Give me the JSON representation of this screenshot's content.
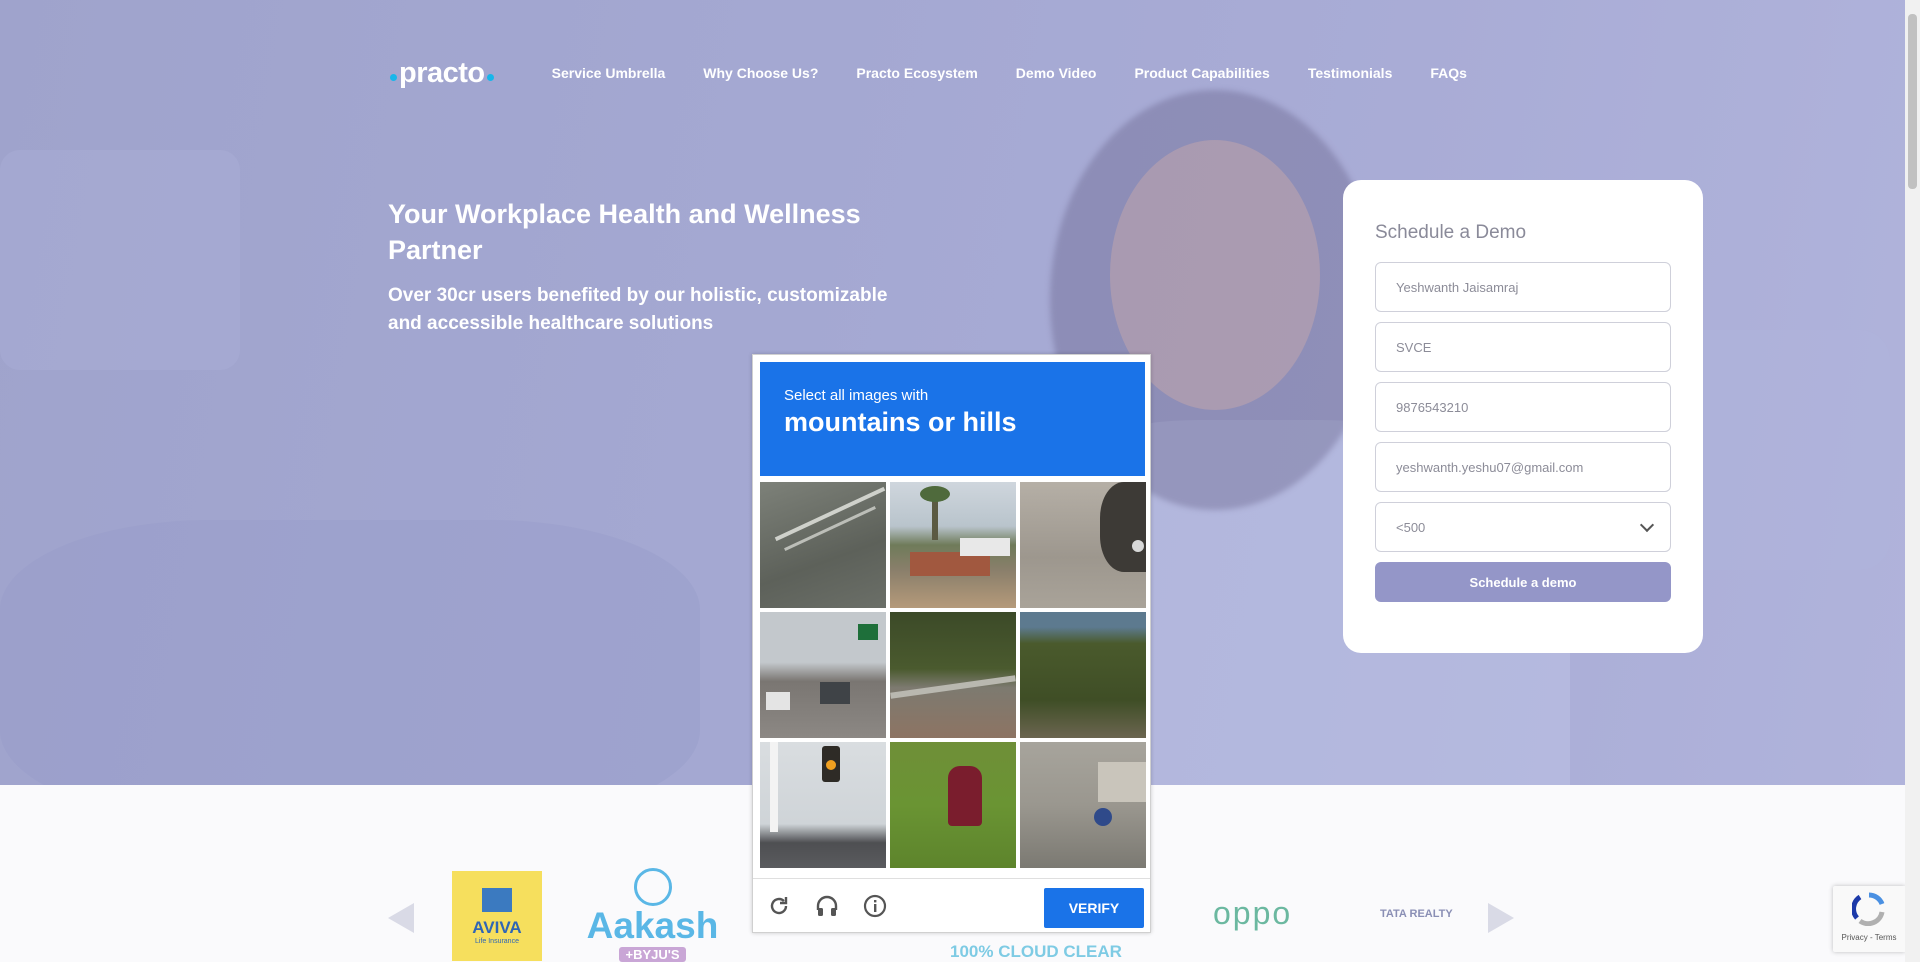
{
  "nav": {
    "logo_text": "practo",
    "items": [
      {
        "label": "Service Umbrella"
      },
      {
        "label": "Why Choose Us?"
      },
      {
        "label": "Practo Ecosystem"
      },
      {
        "label": "Demo Video"
      },
      {
        "label": "Product Capabilities"
      },
      {
        "label": "Testimonials"
      },
      {
        "label": "FAQs"
      }
    ]
  },
  "hero": {
    "headline": "Your Workplace Health and Wellness Partner",
    "subheadline": "Over 30cr users benefited by our holistic, customizable and accessible healthcare solutions"
  },
  "form": {
    "title": "Schedule a Demo",
    "name_value": "Yeshwanth Jaisamraj",
    "company_value": "SVCE",
    "phone_value": "9876543210",
    "email_value": "yeshwanth.yeshu07@gmail.com",
    "size_selected": "<500",
    "submit_label": "Schedule a demo"
  },
  "captcha": {
    "instruction": "Select all images with",
    "target": "mountains or hills",
    "verify_label": "VERIFY",
    "icons": [
      "reload-icon",
      "audio-headphones-icon",
      "info-icon"
    ]
  },
  "partners": {
    "aviva_name": "AVIVA",
    "aviva_sub": "Life Insurance",
    "aakash_name": "Aakash",
    "aakash_sub": "+BYJU'S",
    "cloud_text": "100% CLOUD CLEAR",
    "oppo_name": "oppo",
    "tata_name": "TATA REALTY"
  },
  "badge": {
    "terms": "Privacy - Terms"
  },
  "colors": {
    "hero_bg": "#a4a8d2",
    "captcha_blue": "#1a73e8",
    "button_purple": "#9496c8",
    "practo_dot": "#17b6ea"
  }
}
